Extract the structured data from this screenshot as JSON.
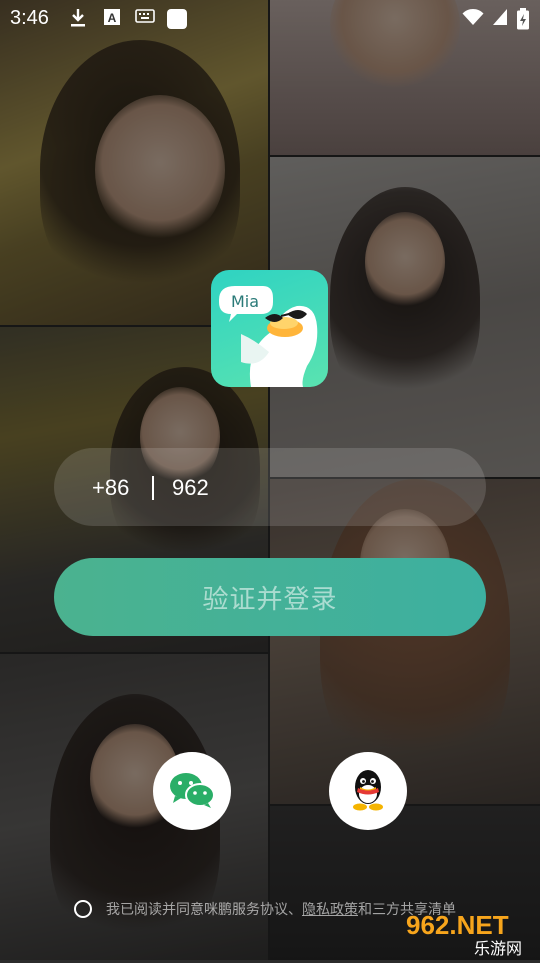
{
  "status_bar": {
    "time": "3:46",
    "icons": [
      "download-icon",
      "a-text-icon",
      "keyboard-icon",
      "app-icon",
      "wifi-icon",
      "battery-charging-icon"
    ]
  },
  "app": {
    "logo_text": "Mia",
    "accent": "#3fb39b"
  },
  "login": {
    "country_code": "+86",
    "phone_value": "962",
    "submit_label": "验证并登录"
  },
  "social": {
    "wechat_icon": "wechat-icon",
    "qq_icon": "qq-icon"
  },
  "agreement": {
    "prefix": "我已阅读并同意咪鹏服务协议、",
    "privacy_link": "隐私政策",
    "conjunction": "和",
    "third_party": "三方共享清单"
  },
  "watermark": {
    "main": "962.NET",
    "sub": "乐游网"
  }
}
